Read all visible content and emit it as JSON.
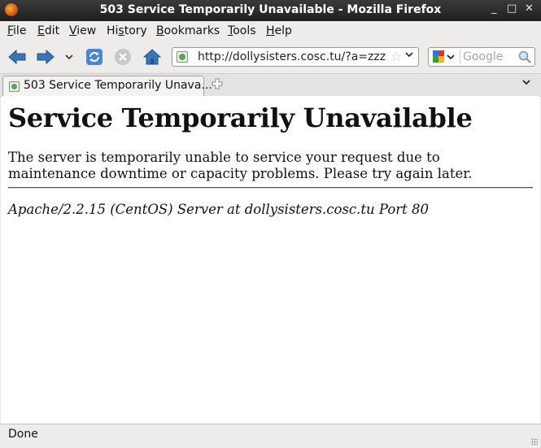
{
  "window": {
    "title": "503 Service Temporarily Unavailable - Mozilla Firefox",
    "controls": {
      "minimize": "_",
      "maximize": "□",
      "close": "✕"
    }
  },
  "menubar": {
    "items": [
      {
        "label": "File",
        "accesskey": "F",
        "rest": "ile"
      },
      {
        "label": "Edit",
        "accesskey": "E",
        "rest": "dit"
      },
      {
        "label": "View",
        "accesskey": "V",
        "rest": "iew"
      },
      {
        "label": "History",
        "pre": "Hi",
        "accesskey": "s",
        "rest": "tory"
      },
      {
        "label": "Bookmarks",
        "accesskey": "B",
        "rest": "ookmarks"
      },
      {
        "label": "Tools",
        "accesskey": "T",
        "rest": "ools"
      },
      {
        "label": "Help",
        "accesskey": "H",
        "rest": "elp"
      }
    ]
  },
  "navbar": {
    "url": "http://dollysisters.cosc.tu/?a=zzz",
    "search_placeholder": "Google",
    "icons": [
      "back-icon",
      "forward-icon",
      "history-dropdown-icon",
      "reload-icon",
      "stop-icon",
      "home-icon"
    ]
  },
  "tabs": [
    {
      "label": "503 Service Temporarily Unava...",
      "active": true
    }
  ],
  "page": {
    "heading": "Service Temporarily Unavailable",
    "message": "The server is temporarily unable to service your request due to maintenance downtime or capacity problems. Please try again later.",
    "server_signature": "Apache/2.2.15 (CentOS) Server at dollysisters.cosc.tu Port 80"
  },
  "statusbar": {
    "text": "Done"
  }
}
